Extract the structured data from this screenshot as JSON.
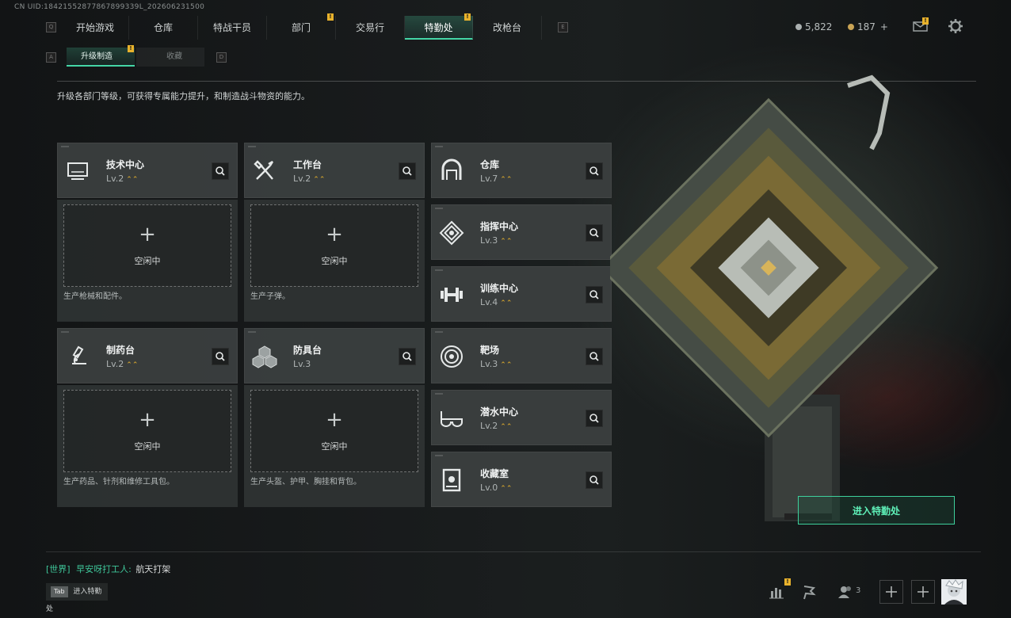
{
  "uid_text": "CN UID:18421552877867899339L_202606231500",
  "nav": {
    "left_key": "Q",
    "right_key": "E",
    "tabs": [
      {
        "label": "开始游戏",
        "badge": ""
      },
      {
        "label": "仓库",
        "badge": ""
      },
      {
        "label": "特战干员",
        "badge": ""
      },
      {
        "label": "部门",
        "badge": "!"
      },
      {
        "label": "交易行",
        "badge": ""
      },
      {
        "label": "特勤处",
        "badge": "!",
        "active": true
      },
      {
        "label": "改枪台",
        "badge": ""
      }
    ]
  },
  "currency": {
    "silver": "5,822",
    "gold": "187",
    "gold_add": "+",
    "mail_badge": "!"
  },
  "subnav": {
    "left_key": "A",
    "right_key": "D",
    "tab1": "升级制造",
    "tab1_badge": "!",
    "tab2": "收藏"
  },
  "description": "升级各部门等级，可获得专属能力提升，和制造战斗物资的能力。",
  "slot_label": "空闲中",
  "slot_plus": "+",
  "workshops": [
    {
      "name": "技术中心",
      "level": "Lv.2",
      "up": true,
      "icon": "monitor-icon",
      "slot_desc": "生产枪械和配件。"
    },
    {
      "name": "工作台",
      "level": "Lv.2",
      "up": true,
      "icon": "tools-icon",
      "slot_desc": "生产子弹。"
    },
    {
      "name": "制药台",
      "level": "Lv.2",
      "up": true,
      "icon": "microscope-icon",
      "slot_desc": "生产药品、针剂和维修工具包。"
    },
    {
      "name": "防具台",
      "level": "Lv.3",
      "up": false,
      "icon": "cubes-icon",
      "slot_desc": "生产头盔、护甲、胸挂和背包。"
    }
  ],
  "departments": [
    {
      "name": "仓库",
      "level": "Lv.7",
      "icon": "garage-icon"
    },
    {
      "name": "指挥中心",
      "level": "Lv.3",
      "icon": "chip-icon"
    },
    {
      "name": "训练中心",
      "level": "Lv.4",
      "icon": "dumbbell-icon"
    },
    {
      "name": "靶场",
      "level": "Lv.3",
      "icon": "target-icon"
    },
    {
      "name": "潜水中心",
      "level": "Lv.2",
      "icon": "diving-mask-icon"
    },
    {
      "name": "收藏室",
      "level": "Lv.0",
      "icon": "trophy-case-icon"
    }
  ],
  "enter_button": "进入特勤处",
  "chat": {
    "channel": "[世界]",
    "user": "早安呀打工人:",
    "message": "航天打架"
  },
  "tab_hint": {
    "key": "Tab",
    "label": "进入特勤处"
  },
  "bottom": {
    "stats_badge": "!",
    "friends_count": "3"
  },
  "colors": {
    "accent": "#44d6a6",
    "badge": "#e8b22c",
    "card": "#3c4040"
  }
}
